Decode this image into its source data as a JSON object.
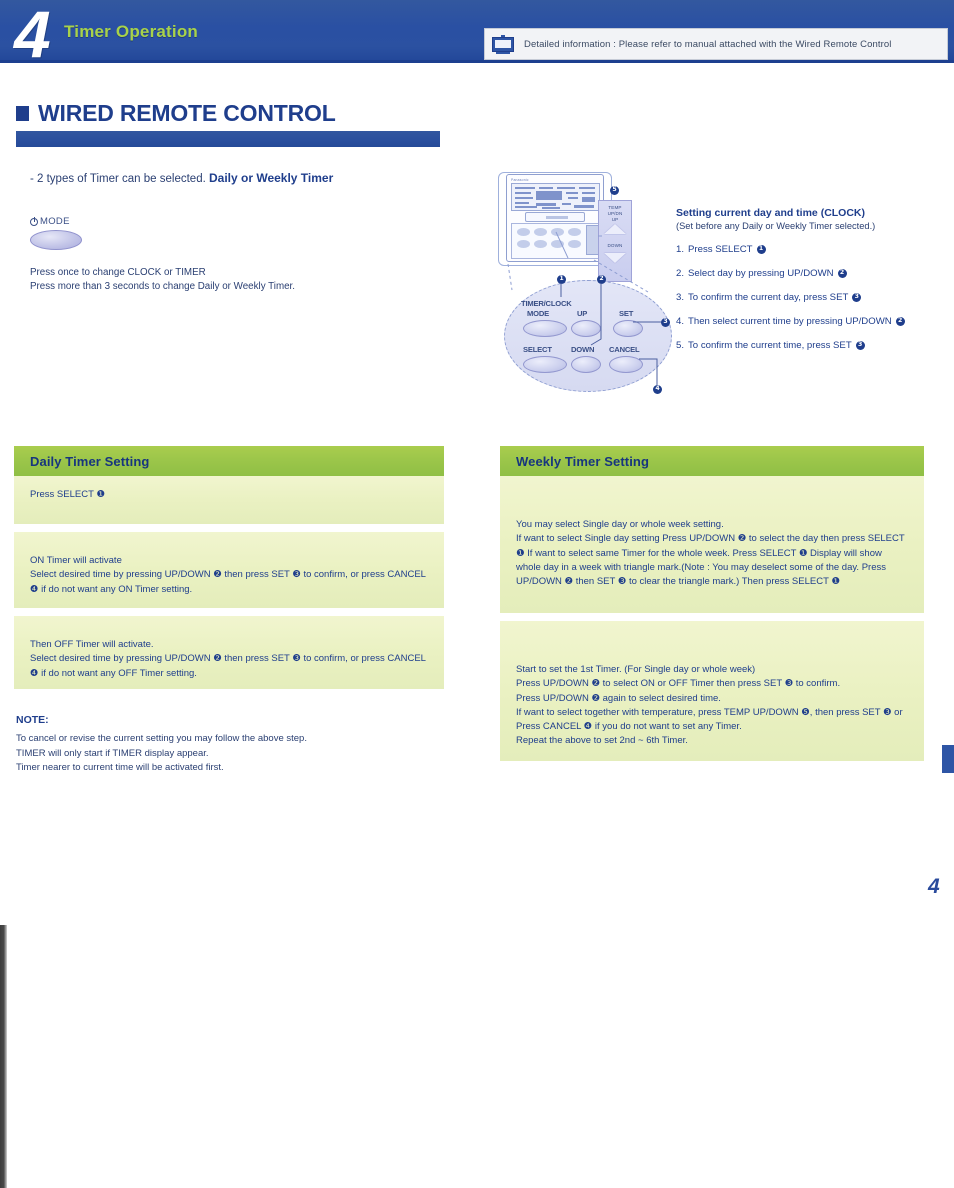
{
  "header": {
    "chapter_number": "4",
    "chapter_title": "Timer Operation",
    "note_icon": "wired-remote-icon",
    "note_text": "Detailed information : Please refer to manual attached with the Wired Remote Control"
  },
  "section": {
    "title": "WIRED REMOTE CONTROL",
    "intro_prefix": "- 2 types of Timer can be selected.",
    "intro_bold": "Daily or Weekly Timer"
  },
  "mode": {
    "button_label": "MODE",
    "power_icon": "power-icon",
    "line1": "Press once to change CLOCK or TIMER",
    "line2": "Press more than 3 seconds to change Daily or Weekly Timer."
  },
  "remote": {
    "brand": "Panasonic",
    "callout_up_label": "TEMP\nUP/DN\nUP",
    "callout_down_label": "DOWN",
    "callout_badge": "5",
    "buttons": [
      {
        "label": "TIMER/CLOCK",
        "badge": "1",
        "name": "timer-clock-label"
      },
      {
        "label": "MODE",
        "badge": "",
        "name": "mode-label"
      },
      {
        "label": "UP",
        "badge": "2",
        "name": "up-button"
      },
      {
        "label": "SET",
        "badge": "3",
        "name": "set-button"
      },
      {
        "label": "SELECT",
        "badge": "1",
        "name": "select-button"
      },
      {
        "label": "DOWN",
        "badge": "2",
        "name": "down-button"
      },
      {
        "label": "CANCEL",
        "badge": "4",
        "name": "cancel-button"
      }
    ]
  },
  "clock": {
    "title": "Setting current day and time (CLOCK)",
    "subtitle": "(Set before any Daily or Weekly Timer selected.)",
    "steps": [
      {
        "num": "1.",
        "text": "Press SELECT",
        "badge": "1"
      },
      {
        "num": "2.",
        "text": "Select day by pressing UP/DOWN",
        "badge": "2"
      },
      {
        "num": "3.",
        "text": "To confirm the current day, press SET",
        "badge": "3"
      },
      {
        "num": "4.",
        "text": "Then select current time by pressing UP/DOWN",
        "badge": "2"
      },
      {
        "num": "5.",
        "text": "To confirm the current time, press SET",
        "badge": "3"
      }
    ]
  },
  "daily": {
    "panel_title": "Daily Timer Setting",
    "block1": "Press SELECT ❶",
    "block2": "ON Timer will activate\nSelect desired time by pressing UP/DOWN ❷ then press SET ❸ to confirm, or press CANCEL ❹ if do not want any ON Timer setting.",
    "block3": "Then OFF Timer will activate.\nSelect desired time by pressing UP/DOWN ❷ then press SET ❸ to confirm, or press CANCEL ❹ if do not want any OFF Timer setting.",
    "note_heading": "NOTE:",
    "note_lines": [
      "To cancel or revise the current setting you may follow the above step.",
      "TIMER will only start if TIMER display appear.",
      "Timer nearer to current time will be activated first."
    ]
  },
  "weekly": {
    "panel_title": "Weekly Timer Setting",
    "block1": "You may select Single day or whole week setting.\nIf want to select Single day setting Press UP/DOWN ❷ to select the day then press SELECT ❶ If want to select same Timer for the whole week. Press SELECT ❶ Display will show whole day in a week with triangle mark.(Note : You may deselect some of the day. Press UP/DOWN ❷ then SET ❸ to clear the  triangle mark.) Then press SELECT ❶",
    "block2": "Start to set the 1st Timer. (For Single day or whole week)\nPress UP/DOWN ❷ to select ON or OFF Timer then press SET ❸ to confirm.\nPress UP/DOWN ❷ again to select desired time.\nIf want to select together with temperature, press TEMP UP/DOWN ❺, then press SET ❸ or Press CANCEL ❹ if you  do not want to set any Timer.\nRepeat the above to set 2nd ~ 6th Timer."
  },
  "footer": {
    "page_number": "4"
  },
  "colors": {
    "header_blue": "#2e55a5",
    "chapter_title_green": "#a8d24a",
    "panel_header_green": "#9cc64a",
    "panel_body_yellow": "#eaf1c2",
    "text_blue": "#1f3e8c"
  }
}
